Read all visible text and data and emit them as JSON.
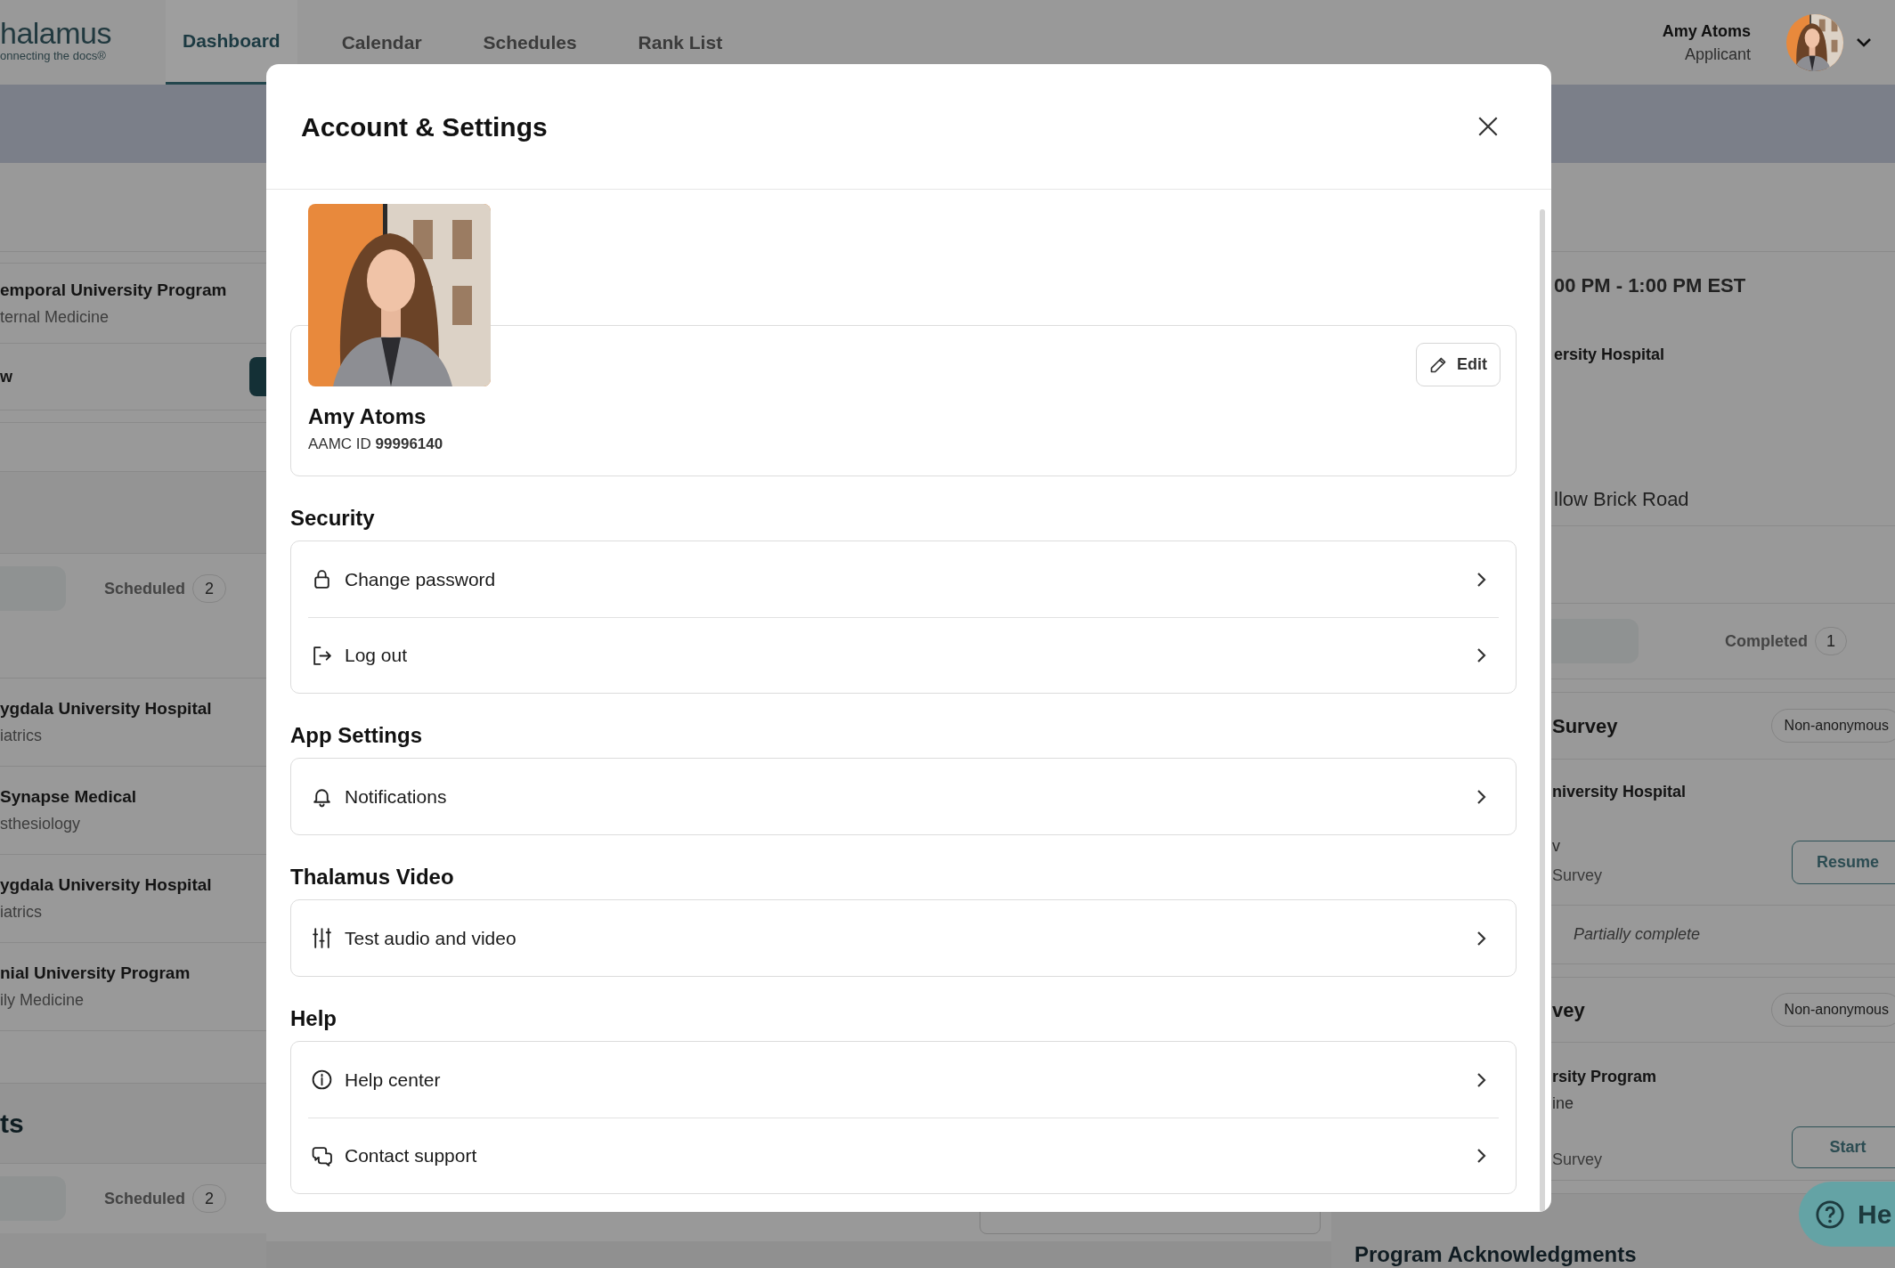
{
  "header": {
    "logo": "halamus",
    "tagline": "onnecting the docs®",
    "tabs": [
      {
        "label": "Dashboard",
        "selected": true
      },
      {
        "label": "Calendar",
        "selected": false
      },
      {
        "label": "Schedules",
        "selected": false
      },
      {
        "label": "Rank List",
        "selected": false
      }
    ],
    "user": {
      "name": "Amy Atoms",
      "role": "Applicant"
    }
  },
  "left_panel": {
    "program": {
      "title": "emporal University Program",
      "subtitle": "ternal Medicine"
    },
    "row_label": "w",
    "filter_tab": {
      "label": "Scheduled",
      "count": "2"
    },
    "list": [
      {
        "title": "ygdala University Hospital",
        "subtitle": "iatrics"
      },
      {
        "title": "Synapse Medical",
        "subtitle": "sthesiology"
      },
      {
        "title": "ygdala University Hospital",
        "subtitle": "iatrics"
      },
      {
        "title": "nial University Program",
        "subtitle": "ily Medicine"
      }
    ],
    "section_title": "ts",
    "filter_tab_2": {
      "label": "Scheduled",
      "count": "2"
    }
  },
  "right_panel": {
    "time": "00 PM - 1:00 PM EST",
    "location": "ersity Hospital",
    "address": "llow Brick Road",
    "filter_tab": {
      "label": "Completed",
      "count": "1"
    },
    "surveys": [
      {
        "title": "Survey",
        "badge": "Non-anonymous",
        "program": "niversity Hospital",
        "line_1": "v",
        "line_2": "Survey",
        "button": "Resume",
        "status": "Partially complete"
      },
      {
        "title": "vey",
        "badge": "Non-anonymous",
        "program": "rsity Program",
        "line_1": "ine",
        "line_2": "Survey",
        "button": "Start"
      }
    ],
    "acknowledgments_title": "Program Acknowledgments"
  },
  "help_button": "He",
  "modal": {
    "title": "Account & Settings",
    "profile": {
      "name": "Amy Atoms",
      "id": "AAMC ID **99996140**",
      "edit": "Edit"
    },
    "sections": [
      {
        "heading": "Security",
        "items": [
          {
            "kind": "password",
            "label": "Change password"
          },
          {
            "kind": "logout",
            "label": "Log out"
          }
        ]
      },
      {
        "heading": "App Settings",
        "items": [
          {
            "kind": "notifications",
            "label": "Notifications"
          }
        ]
      },
      {
        "heading": "Thalamus Video",
        "items": [
          {
            "kind": "av-test",
            "label": "Test audio and video"
          }
        ]
      },
      {
        "heading": "Help",
        "items": [
          {
            "kind": "help",
            "label": "Help center"
          },
          {
            "kind": "support",
            "label": "Contact support"
          }
        ]
      }
    ]
  }
}
